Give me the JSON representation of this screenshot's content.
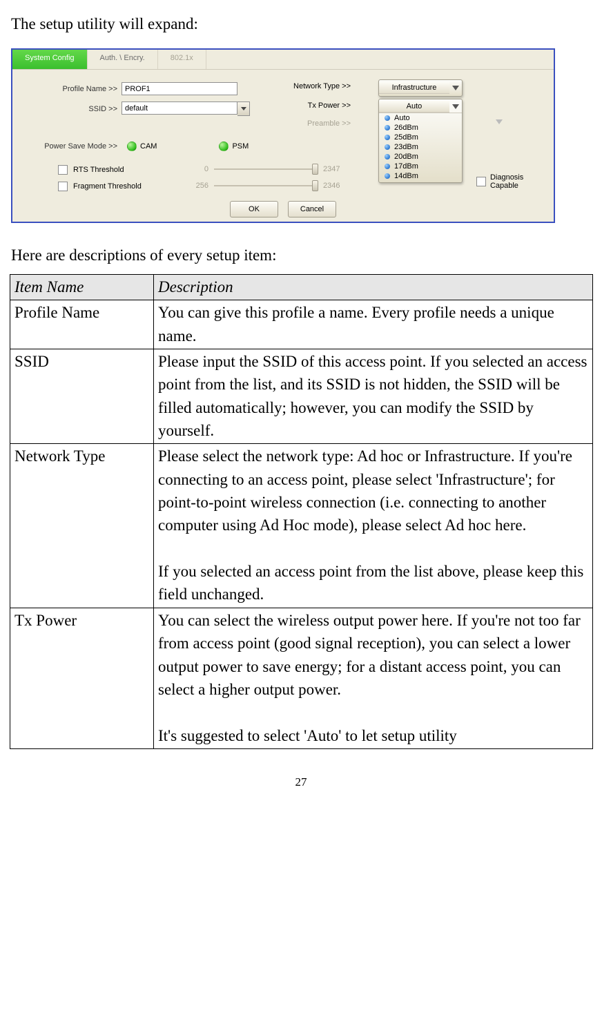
{
  "intro1": "The setup utility will expand:",
  "intro2": "Here are descriptions of every setup item:",
  "page_number": "27",
  "screenshot": {
    "tabs": [
      "System Config",
      "Auth. \\ Encry.",
      "802.1x"
    ],
    "labels": {
      "profile_name": "Profile Name >>",
      "ssid": "SSID >>",
      "network_type": "Network Type >>",
      "tx_power": "Tx Power >>",
      "preamble": "Preamble >>",
      "power_save_mode": "Power Save Mode >>",
      "cam": "CAM",
      "psm": "PSM",
      "rts": "RTS Threshold",
      "frag": "Fragment Threshold",
      "diag": "Diagnosis Capable"
    },
    "values": {
      "profile_name": "PROF1",
      "ssid": "default",
      "network_type": "Infrastructure",
      "tx_power": "Auto",
      "rts_lo": "0",
      "rts_hi": "2347",
      "frag_lo": "256",
      "frag_hi": "2346"
    },
    "tx_options": [
      "Auto",
      "26dBm",
      "25dBm",
      "23dBm",
      "20dBm",
      "17dBm",
      "14dBm"
    ],
    "buttons": {
      "ok": "OK",
      "cancel": "Cancel"
    }
  },
  "table": {
    "head_item": "Item Name",
    "head_desc": "Description",
    "rows": [
      {
        "name": "Profile Name",
        "desc": "You can give this profile a name. Every profile needs a unique name."
      },
      {
        "name": "SSID",
        "desc": "Please input the SSID of this access point. If you selected an access point from the list, and its SSID is not hidden, the SSID will be filled automatically; however, you can modify the SSID by yourself."
      },
      {
        "name": "Network Type",
        "desc_a": "Please select the network type: Ad hoc or Infrastructure. If you're connecting to an access point, please select 'Infrastructure'; for point-to-point wireless connection (i.e. connecting to another computer using Ad Hoc mode), please select Ad hoc here.",
        "desc_b": "If you selected an access point from the list above, please keep this field unchanged."
      },
      {
        "name": "Tx Power",
        "desc_a": "You can select the wireless output power here. If you're not too far from access point (good signal reception), you can select a lower output power to save energy; for a distant access point, you can select a higher output power.",
        "desc_b": "It's suggested to select 'Auto' to let setup utility"
      }
    ]
  }
}
